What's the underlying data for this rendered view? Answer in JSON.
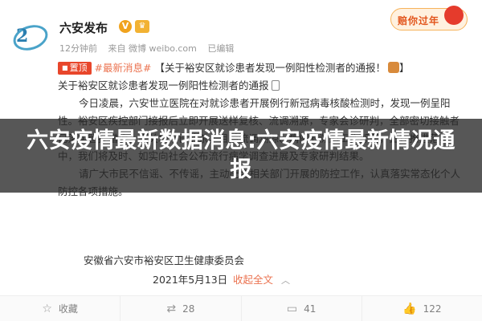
{
  "header": {
    "account_name": "六安发布",
    "verified_badge": "V",
    "vip_badge": "♛",
    "time_ago": "12分钟前",
    "source": "来自 微博 weibo.com",
    "edited": "已编辑",
    "promo_text": "赔你过年"
  },
  "post": {
    "pin_label": "置顶",
    "hashtag": "#最新消息#",
    "headline": "【关于裕安区就诊患者发现一例阳性检测者的通报！",
    "headline_end": "】",
    "subtitle": "关于裕安区就诊患者发现一例阳性检测者的通报",
    "paragraph1": "今日凌晨，六安世立医院在对就诊患者开展例行新冠病毒核酸检测时，发现一例呈阳性。裕安区疾控部门接报后立即开展送样复核、流调溯源，专家会诊研判，全部密切接触者已落实管控措施，相关场所已消杀，目前流调溯源、病例的溯源工作部署，正在推进落实中，我们将及时、如实向社会公布流行病学调查进展及专家研判结果。",
    "paragraph2": "请广大市民不信谣、不传谣，主动配合相关部门开展的防控工作，认真落实常态化个人防控各项措施。",
    "signature": "安徽省六安市裕安区卫生健康委员会",
    "date": "2021年5月13日",
    "collapse_label": "收起全文",
    "collapse_icon": "chevron-up-icon"
  },
  "actions": {
    "favorite": "收藏",
    "repost_count": "28",
    "comment_count": "41",
    "like_count": "122"
  },
  "banner": {
    "title": "六安疫情最新数据消息:六安疫情最新情况通报"
  },
  "colors": {
    "hashtag": "#eb7350",
    "pin": "#e8462b",
    "banner_bg": "#282828"
  }
}
